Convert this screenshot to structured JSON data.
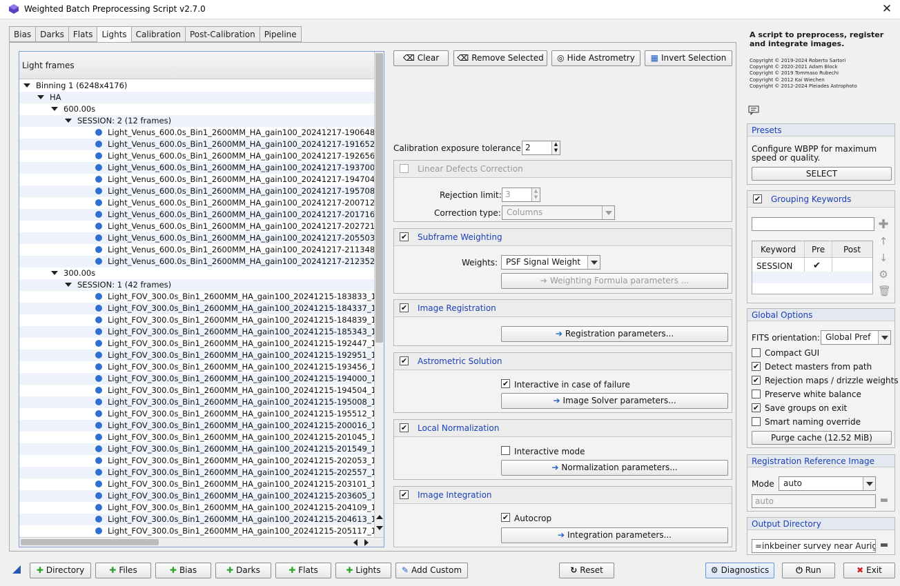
{
  "window": {
    "title": "Weighted Batch Preprocessing Script v2.7.0",
    "close_symbol": "✕"
  },
  "tabs": [
    "Bias",
    "Darks",
    "Flats",
    "Lights",
    "Calibration",
    "Post-Calibration",
    "Pipeline"
  ],
  "tree": {
    "header": "Light frames",
    "binning": "Binning 1 (6248x4176)",
    "filter": "HA",
    "exp1": "600.00s",
    "session1": "SESSION: 2 (12 frames)",
    "files1": [
      "Light_Venus_600.0s_Bin1_2600MM_HA_gain100_20241217-190648",
      "Light_Venus_600.0s_Bin1_2600MM_HA_gain100_20241217-191652",
      "Light_Venus_600.0s_Bin1_2600MM_HA_gain100_20241217-192656",
      "Light_Venus_600.0s_Bin1_2600MM_HA_gain100_20241217-193700",
      "Light_Venus_600.0s_Bin1_2600MM_HA_gain100_20241217-194704",
      "Light_Venus_600.0s_Bin1_2600MM_HA_gain100_20241217-195708",
      "Light_Venus_600.0s_Bin1_2600MM_HA_gain100_20241217-200712",
      "Light_Venus_600.0s_Bin1_2600MM_HA_gain100_20241217-201716",
      "Light_Venus_600.0s_Bin1_2600MM_HA_gain100_20241217-202721",
      "Light_Venus_600.0s_Bin1_2600MM_HA_gain100_20241217-205503",
      "Light_Venus_600.0s_Bin1_2600MM_HA_gain100_20241217-211348",
      "Light_Venus_600.0s_Bin1_2600MM_HA_gain100_20241217-212352"
    ],
    "exp2": "300.00s",
    "session2": "SESSION: 1 (42 frames)",
    "files2": [
      "Light_FOV_300.0s_Bin1_2600MM_HA_gain100_20241215-183833_1",
      "Light_FOV_300.0s_Bin1_2600MM_HA_gain100_20241215-184337_1",
      "Light_FOV_300.0s_Bin1_2600MM_HA_gain100_20241215-184839_1",
      "Light_FOV_300.0s_Bin1_2600MM_HA_gain100_20241215-185343_1",
      "Light_FOV_300.0s_Bin1_2600MM_HA_gain100_20241215-192447_1",
      "Light_FOV_300.0s_Bin1_2600MM_HA_gain100_20241215-192951_1",
      "Light_FOV_300.0s_Bin1_2600MM_HA_gain100_20241215-193456_1",
      "Light_FOV_300.0s_Bin1_2600MM_HA_gain100_20241215-194000_1",
      "Light_FOV_300.0s_Bin1_2600MM_HA_gain100_20241215-194504_1",
      "Light_FOV_300.0s_Bin1_2600MM_HA_gain100_20241215-195008_1",
      "Light_FOV_300.0s_Bin1_2600MM_HA_gain100_20241215-195512_1",
      "Light_FOV_300.0s_Bin1_2600MM_HA_gain100_20241215-200016_1",
      "Light_FOV_300.0s_Bin1_2600MM_HA_gain100_20241215-201045_1",
      "Light_FOV_300.0s_Bin1_2600MM_HA_gain100_20241215-201549_1",
      "Light_FOV_300.0s_Bin1_2600MM_HA_gain100_20241215-202053_1",
      "Light_FOV_300.0s_Bin1_2600MM_HA_gain100_20241215-202557_1",
      "Light_FOV_300.0s_Bin1_2600MM_HA_gain100_20241215-203101_1",
      "Light_FOV_300.0s_Bin1_2600MM_HA_gain100_20241215-203605_1",
      "Light_FOV_300.0s_Bin1_2600MM_HA_gain100_20241215-204109_1",
      "Light_FOV_300.0s_Bin1_2600MM_HA_gain100_20241215-204613_1",
      "Light_FOV_300.0s_Bin1_2600MM_HA_gain100_20241215-205117_1"
    ]
  },
  "toolbar": {
    "clear": "Clear",
    "remove_selected": "Remove Selected",
    "hide_astrometry": "Hide Astrometry",
    "invert_selection": "Invert Selection"
  },
  "calibration_tolerance": {
    "label": "Calibration exposure tolerance:",
    "value": "2"
  },
  "linear_defects": {
    "title": "Linear Defects Correction",
    "rejection_label": "Rejection limit:",
    "rejection_value": "3",
    "correction_label": "Correction type:",
    "correction_value": "Columns"
  },
  "subframe_weighting": {
    "title": "Subframe Weighting",
    "weights_label": "Weights:",
    "weights_value": "PSF Signal Weight",
    "formula_button": "Weighting Formula parameters ..."
  },
  "image_registration": {
    "title": "Image Registration",
    "button": "Registration parameters..."
  },
  "astrometric_solution": {
    "title": "Astrometric Solution",
    "interactive_label": "Interactive in case of failure",
    "button": "Image Solver parameters..."
  },
  "local_normalization": {
    "title": "Local Normalization",
    "interactive_label": "Interactive mode",
    "button": "Normalization parameters..."
  },
  "image_integration": {
    "title": "Image Integration",
    "autocrop_label": "Autocrop",
    "button": "Integration parameters..."
  },
  "info": {
    "description": "A script to preprocess, register and integrate images.",
    "copyrights": [
      "Copyright © 2019-2024 Roberto Sartori",
      "Copyright © 2020-2021 Adam Block",
      "Copyright © 2019 Tommaso Rubechi",
      "Copyright © 2012 Kai Wiechen",
      "Copyright © 2012-2024 Pleiades Astrophoto"
    ]
  },
  "presets": {
    "title": "Presets",
    "text1": "Configure WBPP for maximum",
    "text2": "speed or quality.",
    "button": "SELECT"
  },
  "grouping": {
    "title": "Grouping Keywords",
    "col_keyword": "Keyword",
    "col_pre": "Pre",
    "col_post": "Post",
    "row_keyword": "SESSION",
    "row_pre": "✔"
  },
  "global_options": {
    "title": "Global Options",
    "fits_label": "FITS orientation:",
    "fits_value": "Global Pref",
    "compact_gui": "Compact GUI",
    "detect_masters": "Detect masters from path",
    "rejection_maps": "Rejection maps / drizzle weights",
    "preserve_wb": "Preserve white balance",
    "save_groups": "Save groups on exit",
    "smart_naming": "Smart naming override",
    "purge_button": "Purge cache (12.52 MiB)"
  },
  "reg_reference": {
    "title": "Registration Reference Image",
    "mode_label": "Mode",
    "mode_value": "auto",
    "path_value": "auto"
  },
  "output_dir": {
    "title": "Output Directory",
    "path": "=inkbeiner survey near Auriga"
  },
  "bottom": {
    "directory": "Directory",
    "files": "Files",
    "bias": "Bias",
    "darks": "Darks",
    "flats": "Flats",
    "lights": "Lights",
    "add_custom": "Add Custom",
    "reset": "Reset",
    "diagnostics": "Diagnostics",
    "run": "Run",
    "exit": "Exit"
  },
  "colors": {
    "accent_blue": "#1a40b8",
    "selection_blue": "#2f6fd0",
    "check_green": "#2aa32a",
    "exit_red": "#d02222"
  }
}
